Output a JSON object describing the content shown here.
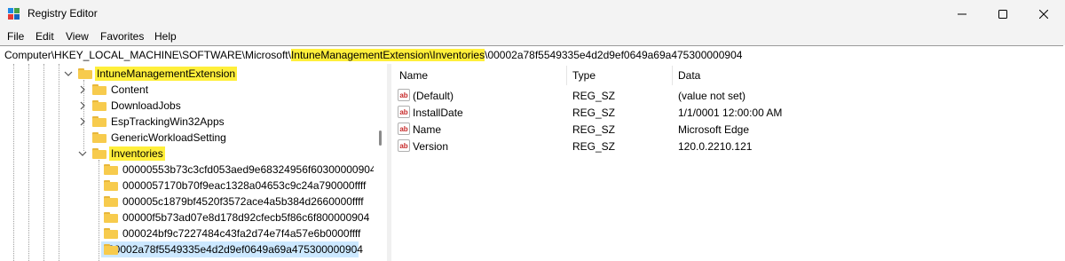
{
  "window": {
    "title": "Registry Editor"
  },
  "menu": [
    "File",
    "Edit",
    "View",
    "Favorites",
    "Help"
  ],
  "address": {
    "prefix": "Computer\\HKEY_LOCAL_MACHINE\\SOFTWARE\\Microsoft\\",
    "highlight": "IntuneManagementExtension\\Inventories",
    "suffix": "\\00002a78f5549335e4d2d9ef0649a69a475300000904"
  },
  "tree": {
    "root": "IntuneManagementExtension",
    "children": [
      "Content",
      "DownloadJobs",
      "EspTrackingWin32Apps",
      "GenericWorkloadSetting"
    ],
    "inventories": "Inventories",
    "subkeys": [
      "00000553b73c3cfd053aed9e68324956f60300000904",
      "0000057170b70f9eac1328a04653c9c24a790000ffff",
      "000005c1879bf4520f3572ace4a5b384d2660000ffff",
      "00000f5b73ad07e8d178d92cfecb5f86c6f800000904",
      "000024bf9c7227484c43fa2d74e7f4a57e6b0000ffff",
      "00002a78f5549335e4d2d9ef0649a69a475300000904"
    ]
  },
  "list": {
    "columns": [
      "Name",
      "Type",
      "Data"
    ],
    "rows": [
      {
        "name": "(Default)",
        "type": "REG_SZ",
        "data": "(value not set)"
      },
      {
        "name": "InstallDate",
        "type": "REG_SZ",
        "data": "1/1/0001 12:00:00 AM"
      },
      {
        "name": "Name",
        "type": "REG_SZ",
        "data": "Microsoft Edge"
      },
      {
        "name": "Version",
        "type": "REG_SZ",
        "data": "120.0.2210.121"
      }
    ],
    "value_icon": "ab"
  },
  "colors": {
    "highlight": "#ffef3a",
    "selection": "#cce8ff",
    "folder": "#f7cb4d"
  }
}
